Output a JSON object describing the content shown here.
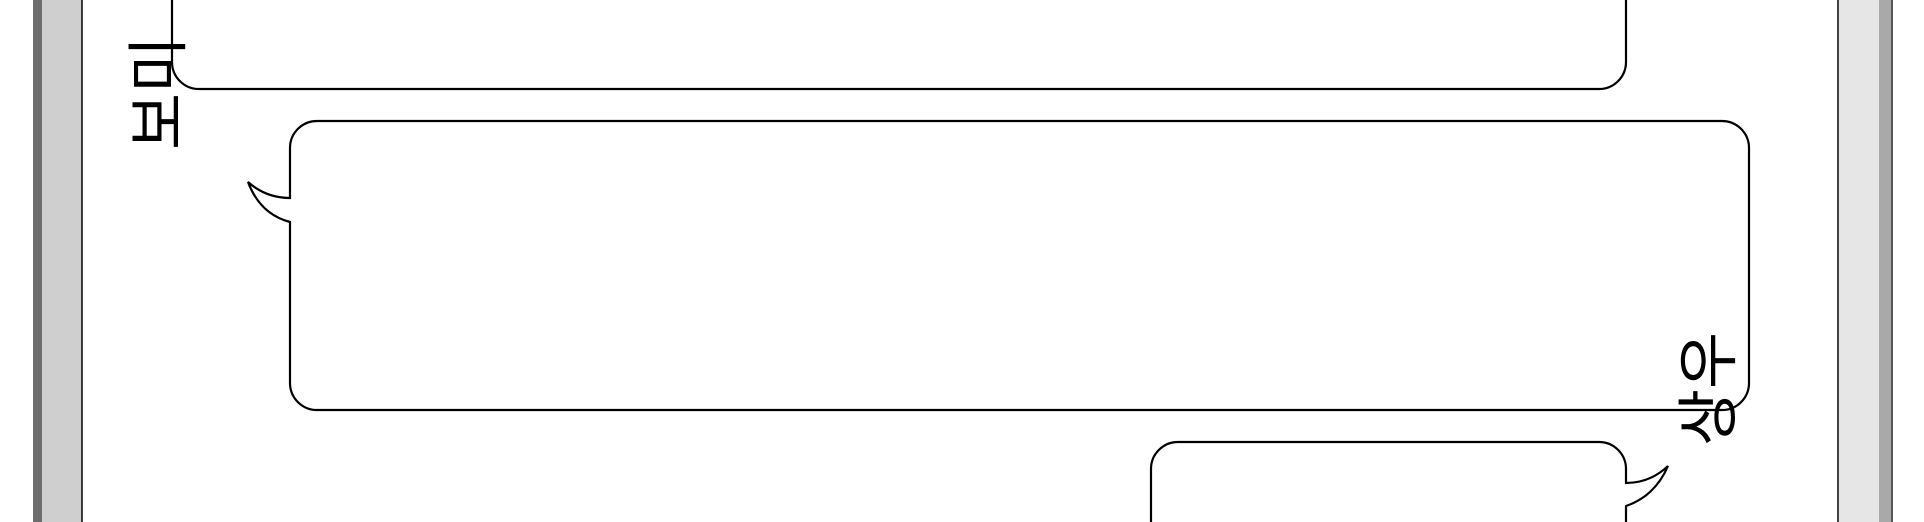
{
  "speakers": {
    "bomi": "보미",
    "sangwoo": "상우"
  },
  "colors": {
    "frame_dark": "#6d6d6d",
    "frame_light_left": "#cfcfcf",
    "frame_light_right": "#e6e6e6",
    "frame_mid_right": "#a9a9a9",
    "stroke": "#000000",
    "page": "#ffffff"
  }
}
